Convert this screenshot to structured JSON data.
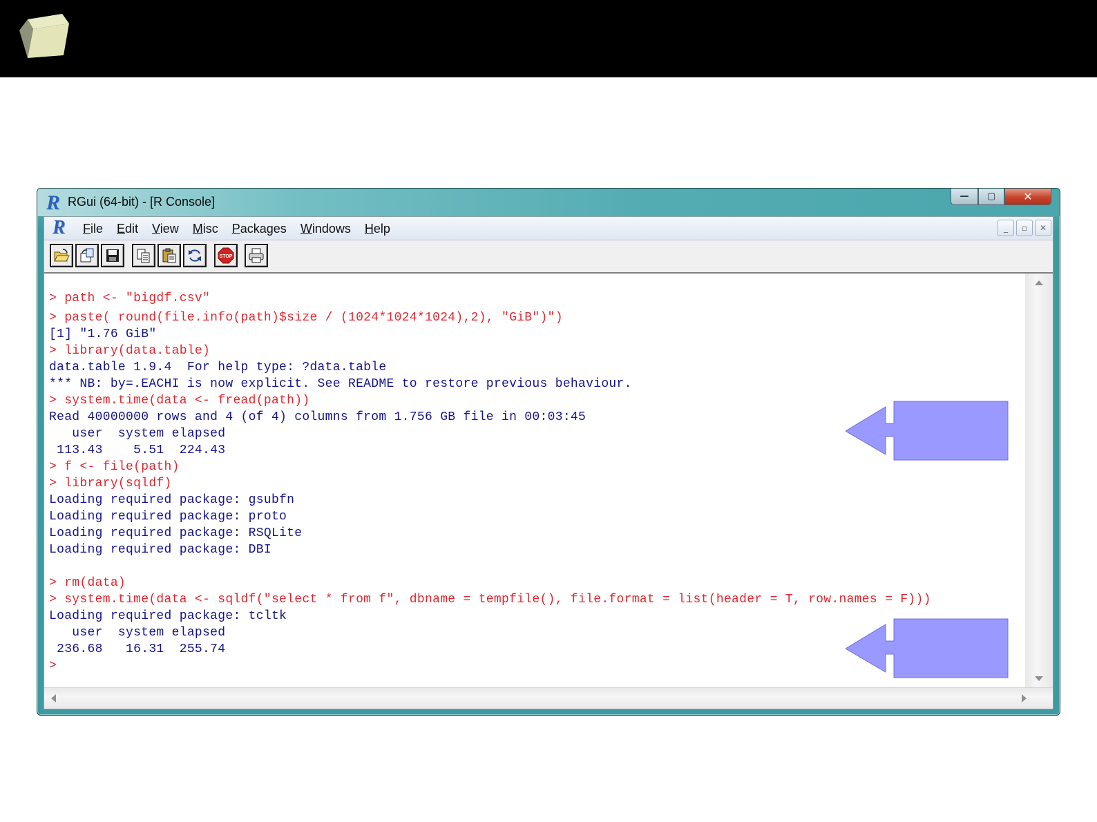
{
  "window": {
    "title": "RGui (64-bit) - [R Console]",
    "close_glyph": "✕",
    "minimize_glyph": "—",
    "maximize_glyph": "▢"
  },
  "menu": {
    "items": [
      {
        "key": "F",
        "rest": "ile"
      },
      {
        "key": "E",
        "rest": "dit"
      },
      {
        "key": "V",
        "rest": "iew"
      },
      {
        "key": "M",
        "rest": "isc"
      },
      {
        "key": "P",
        "rest": "ackages"
      },
      {
        "key": "W",
        "rest": "indows"
      },
      {
        "key": "H",
        "rest": "elp"
      }
    ],
    "mdi": {
      "minimize": "_",
      "restore": "▫",
      "close": "✕"
    }
  },
  "toolbar": {
    "buttons": [
      {
        "icon": "open-folder-icon"
      },
      {
        "icon": "load-workspace-icon"
      },
      {
        "icon": "save-icon"
      },
      {
        "icon": "copy-icon"
      },
      {
        "icon": "paste-icon"
      },
      {
        "icon": "refresh-icon"
      },
      {
        "icon": "stop-icon",
        "label": "STOP"
      },
      {
        "icon": "print-icon"
      }
    ]
  },
  "console": {
    "lines": [
      {
        "type": "input",
        "text": "> path <- \"bigdf.csv\""
      },
      {
        "type": "input",
        "text": "> paste( round(file.info(path)$size / (1024*1024*1024),2), \"GiB\")\")"
      },
      {
        "type": "output",
        "text": "[1] \"1.76 GiB\""
      },
      {
        "type": "input",
        "text": "> library(data.table)"
      },
      {
        "type": "output",
        "text": "data.table 1.9.4  For help type: ?data.table"
      },
      {
        "type": "output",
        "text": "*** NB: by=.EACHI is now explicit. See README to restore previous behaviour."
      },
      {
        "type": "input",
        "text": "> system.time(data <- fread(path))"
      },
      {
        "type": "output",
        "text": "Read 40000000 rows and 4 (of 4) columns from 1.756 GB file in 00:03:45"
      },
      {
        "type": "output",
        "text": "   user  system elapsed"
      },
      {
        "type": "output",
        "text": " 113.43    5.51  224.43"
      },
      {
        "type": "input",
        "text": "> f <- file(path)"
      },
      {
        "type": "input",
        "text": "> library(sqldf)"
      },
      {
        "type": "output",
        "text": "Loading required package: gsubfn"
      },
      {
        "type": "output",
        "text": "Loading required package: proto"
      },
      {
        "type": "output",
        "text": "Loading required package: RSQLite"
      },
      {
        "type": "output",
        "text": "Loading required package: DBI"
      },
      {
        "type": "output",
        "text": ""
      },
      {
        "type": "input",
        "text": "> rm(data)"
      },
      {
        "type": "input",
        "text": "> system.time(data <- sqldf(\"select * from f\", dbname = tempfile(), file.format = list(header = T, row.names = F)))"
      },
      {
        "type": "output",
        "text": "Loading required package: tcltk"
      },
      {
        "type": "output",
        "text": "   user  system elapsed"
      },
      {
        "type": "output",
        "text": " 236.68   16.31  255.74"
      },
      {
        "type": "input",
        "text": ">"
      }
    ]
  },
  "colors": {
    "input": "#e3262e",
    "output": "#14148c",
    "callout_fill": "#9999ff",
    "topbar": "#000000"
  }
}
